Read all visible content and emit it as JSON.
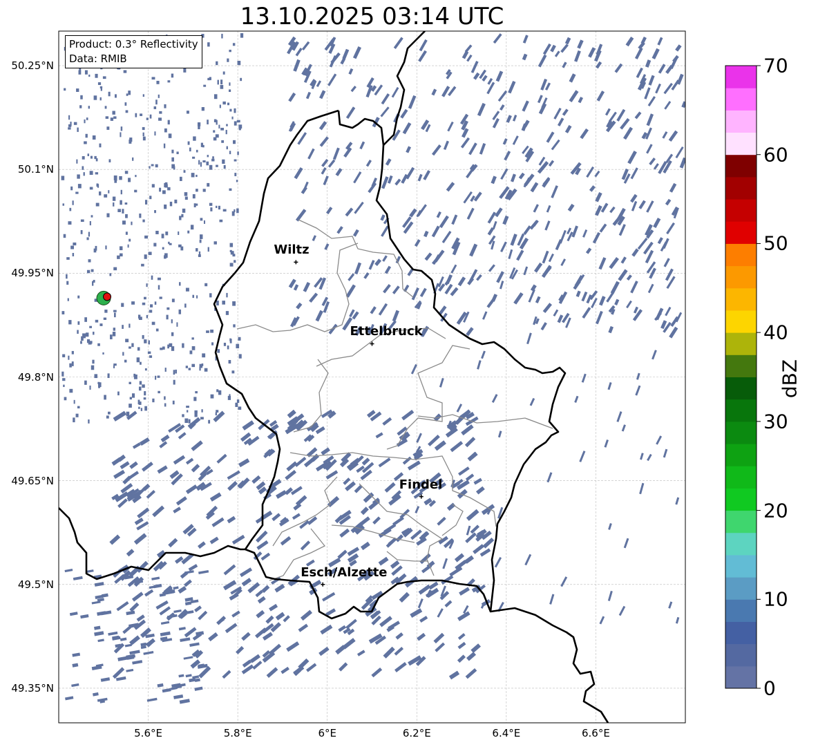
{
  "title": "13.10.2025 03:14 UTC",
  "info_box": {
    "product": "Product: 0.3° Reflectivity",
    "data": "Data: RMIB"
  },
  "map": {
    "lon_range": [
      5.4,
      6.8
    ],
    "lat_range": [
      49.3,
      50.3
    ],
    "lat_ticks": [
      {
        "value": 50.25,
        "label": "50.25°N"
      },
      {
        "value": 50.1,
        "label": "50.1°N"
      },
      {
        "value": 49.95,
        "label": "49.95°N"
      },
      {
        "value": 49.8,
        "label": "49.8°N"
      },
      {
        "value": 49.65,
        "label": "49.65°N"
      },
      {
        "value": 49.5,
        "label": "49.5°N"
      },
      {
        "value": 49.35,
        "label": "49.35°N"
      }
    ],
    "lon_ticks": [
      {
        "value": 5.6,
        "label": "5.6°E"
      },
      {
        "value": 5.8,
        "label": "5.8°E"
      },
      {
        "value": 6.0,
        "label": "6°E"
      },
      {
        "value": 6.2,
        "label": "6.2°E"
      },
      {
        "value": 6.4,
        "label": "6.4°E"
      },
      {
        "value": 6.6,
        "label": "6.6°E"
      }
    ],
    "cities": [
      {
        "name": "Wiltz",
        "lon": 5.93,
        "lat": 49.966
      },
      {
        "name": "Ettelbruck",
        "lon": 6.1,
        "lat": 49.848
      },
      {
        "name": "Findel",
        "lon": 6.21,
        "lat": 49.627
      },
      {
        "name": "Esch/Alzette",
        "lon": 5.99,
        "lat": 49.5
      }
    ],
    "radar_site": {
      "lon": 5.505,
      "lat": 49.914
    },
    "echo_color": "#6073a0"
  },
  "colorbar": {
    "label": "dBZ",
    "min": 0,
    "max": 70,
    "ticks": [
      {
        "value": 0,
        "label": "0"
      },
      {
        "value": 10,
        "label": "10"
      },
      {
        "value": 20,
        "label": "20"
      },
      {
        "value": 30,
        "label": "30"
      },
      {
        "value": 40,
        "label": "40"
      },
      {
        "value": 50,
        "label": "50"
      },
      {
        "value": 60,
        "label": "60"
      },
      {
        "value": 70,
        "label": "70"
      }
    ],
    "colors": [
      "#6473a5",
      "#5469a1",
      "#4460a3",
      "#4a79b0",
      "#5b9cc4",
      "#62bcd5",
      "#5dd4c0",
      "#3fd66e",
      "#10c921",
      "#10b919",
      "#0ea212",
      "#0b8a10",
      "#08760c",
      "#075c09",
      "#44780e",
      "#adb40a",
      "#fdd500",
      "#fcb600",
      "#fc9900",
      "#fd7e00",
      "#e00000",
      "#c50000",
      "#a20000",
      "#7f0000",
      "#ffe1ff",
      "#ffb4ff",
      "#ff6fff",
      "#ea33ea"
    ]
  }
}
